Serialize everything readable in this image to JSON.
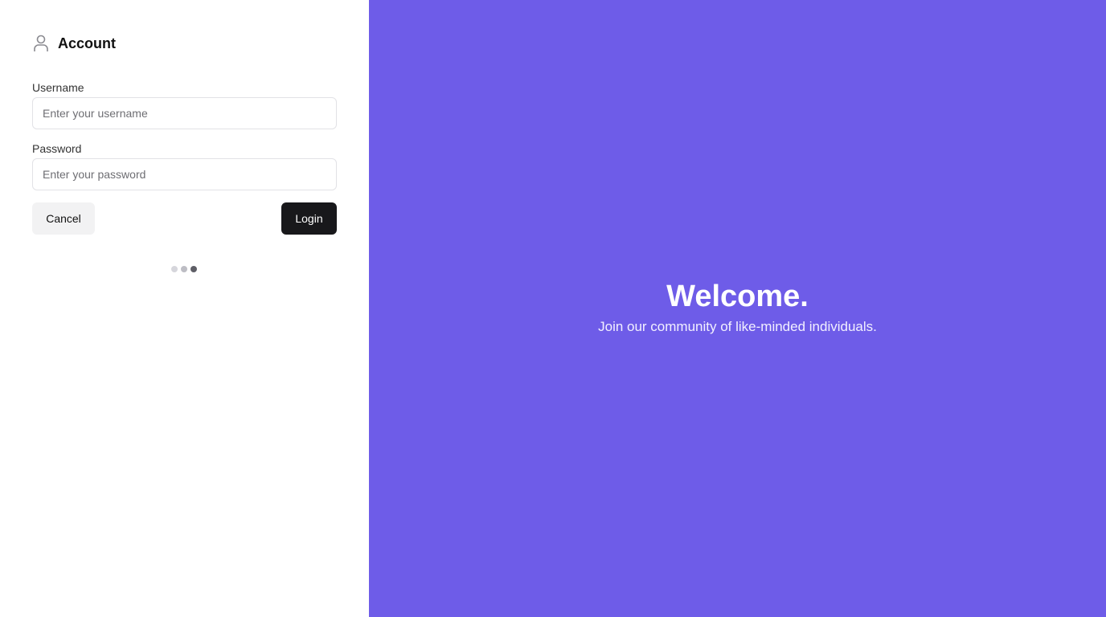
{
  "account": {
    "title": "Account",
    "icon": "user-icon"
  },
  "form": {
    "username_label": "Username",
    "username_placeholder": "Enter your username",
    "username_value": "",
    "password_label": "Password",
    "password_placeholder": "Enter your password",
    "password_value": "",
    "cancel_label": "Cancel",
    "login_label": "Login"
  },
  "pager": {
    "count": 3,
    "active": 3
  },
  "hero": {
    "title": "Welcome.",
    "subtitle": "Join our community of like-minded individuals.",
    "background_color": "#6e5ce8"
  }
}
